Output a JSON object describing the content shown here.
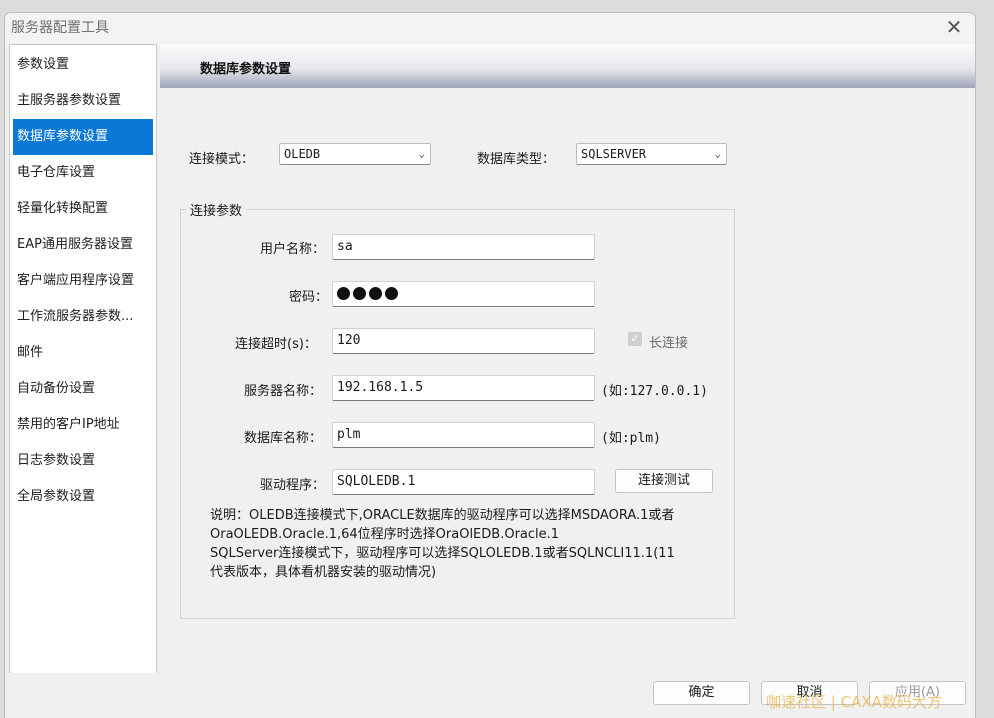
{
  "window": {
    "title": "服务器配置工具",
    "close_glyph": "✕"
  },
  "sidebar": {
    "items": [
      {
        "label": "参数设置"
      },
      {
        "label": "主服务器参数设置"
      },
      {
        "label": "数据库参数设置",
        "active": true
      },
      {
        "label": "电子仓库设置"
      },
      {
        "label": "轻量化转换配置"
      },
      {
        "label": "EAP通用服务器设置"
      },
      {
        "label": "客户端应用程序设置"
      },
      {
        "label": "工作流服务器参数..."
      },
      {
        "label": "邮件"
      },
      {
        "label": "自动备份设置"
      },
      {
        "label": "禁用的客户IP地址"
      },
      {
        "label": "日志参数设置"
      },
      {
        "label": "全局参数设置"
      }
    ]
  },
  "content": {
    "title": "数据库参数设置",
    "connection_mode": {
      "label": "连接模式：",
      "value": "OLEDB"
    },
    "db_type": {
      "label": "数据库类型：",
      "value": "SQLSERVER"
    },
    "group_title": "连接参数",
    "username": {
      "label": "用户名称：",
      "value": "sa"
    },
    "password": {
      "label": "密码：",
      "masked_count": 4
    },
    "timeout": {
      "label": "连接超时(s)：",
      "value": "120"
    },
    "long_connection": {
      "label": "长连接",
      "checked": true,
      "enabled": false
    },
    "server_name": {
      "label": "服务器名称：",
      "value": "192.168.1.5",
      "hint": "(如:127.0.0.1)"
    },
    "db_name": {
      "label": "数据库名称：",
      "value": "plm",
      "hint": "(如:plm)"
    },
    "driver": {
      "label": "驱动程序：",
      "value": "SQLOLEDB.1"
    },
    "test_button": "连接测试",
    "note_lines": [
      "说明：OLEDB连接模式下,ORACLE数据库的驱动程序可以选择MSDAORA.1或者",
      "OraOLEDB.Oracle.1,64位程序时选择OraOlEDB.Oracle.1",
      "SQLServer连接模式下，驱动程序可以选择SQLOLEDB.1或者SQLNCLI11.1(11",
      "代表版本，具体看机器安装的驱动情况)"
    ]
  },
  "footer": {
    "ok": "确定",
    "cancel": "取消",
    "apply": "应用(A)"
  },
  "watermark": "咖速社区 | CAXA数码大方",
  "colors": {
    "active_item": "#0a78d7",
    "header_gradient_end": "#9ea3b8"
  }
}
